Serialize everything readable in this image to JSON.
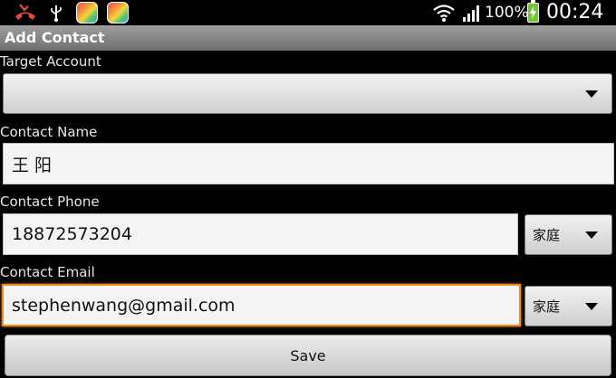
{
  "status_bar": {
    "icons": [
      "missed-call-icon",
      "usb-icon",
      "app-icon",
      "app-icon",
      "wifi-icon",
      "signal-icon",
      "battery-charging-icon"
    ],
    "battery_percent": "100%",
    "time": "00:24"
  },
  "title_bar": {
    "title": "Add Contact"
  },
  "form": {
    "target_account": {
      "label": "Target Account",
      "selected": ""
    },
    "contact_name": {
      "label": "Contact Name",
      "value": "王 阳"
    },
    "contact_phone": {
      "label": "Contact Phone",
      "value": "18872573204",
      "type_selected": "家庭"
    },
    "contact_email": {
      "label": "Contact Email",
      "value": "stephenwang@gmail.com",
      "type_selected": "家庭"
    },
    "save_label": "Save"
  },
  "colors": {
    "focus_accent": "#f08a1a",
    "battery": "#6cc92e",
    "missed_call": "#e24a3b"
  }
}
